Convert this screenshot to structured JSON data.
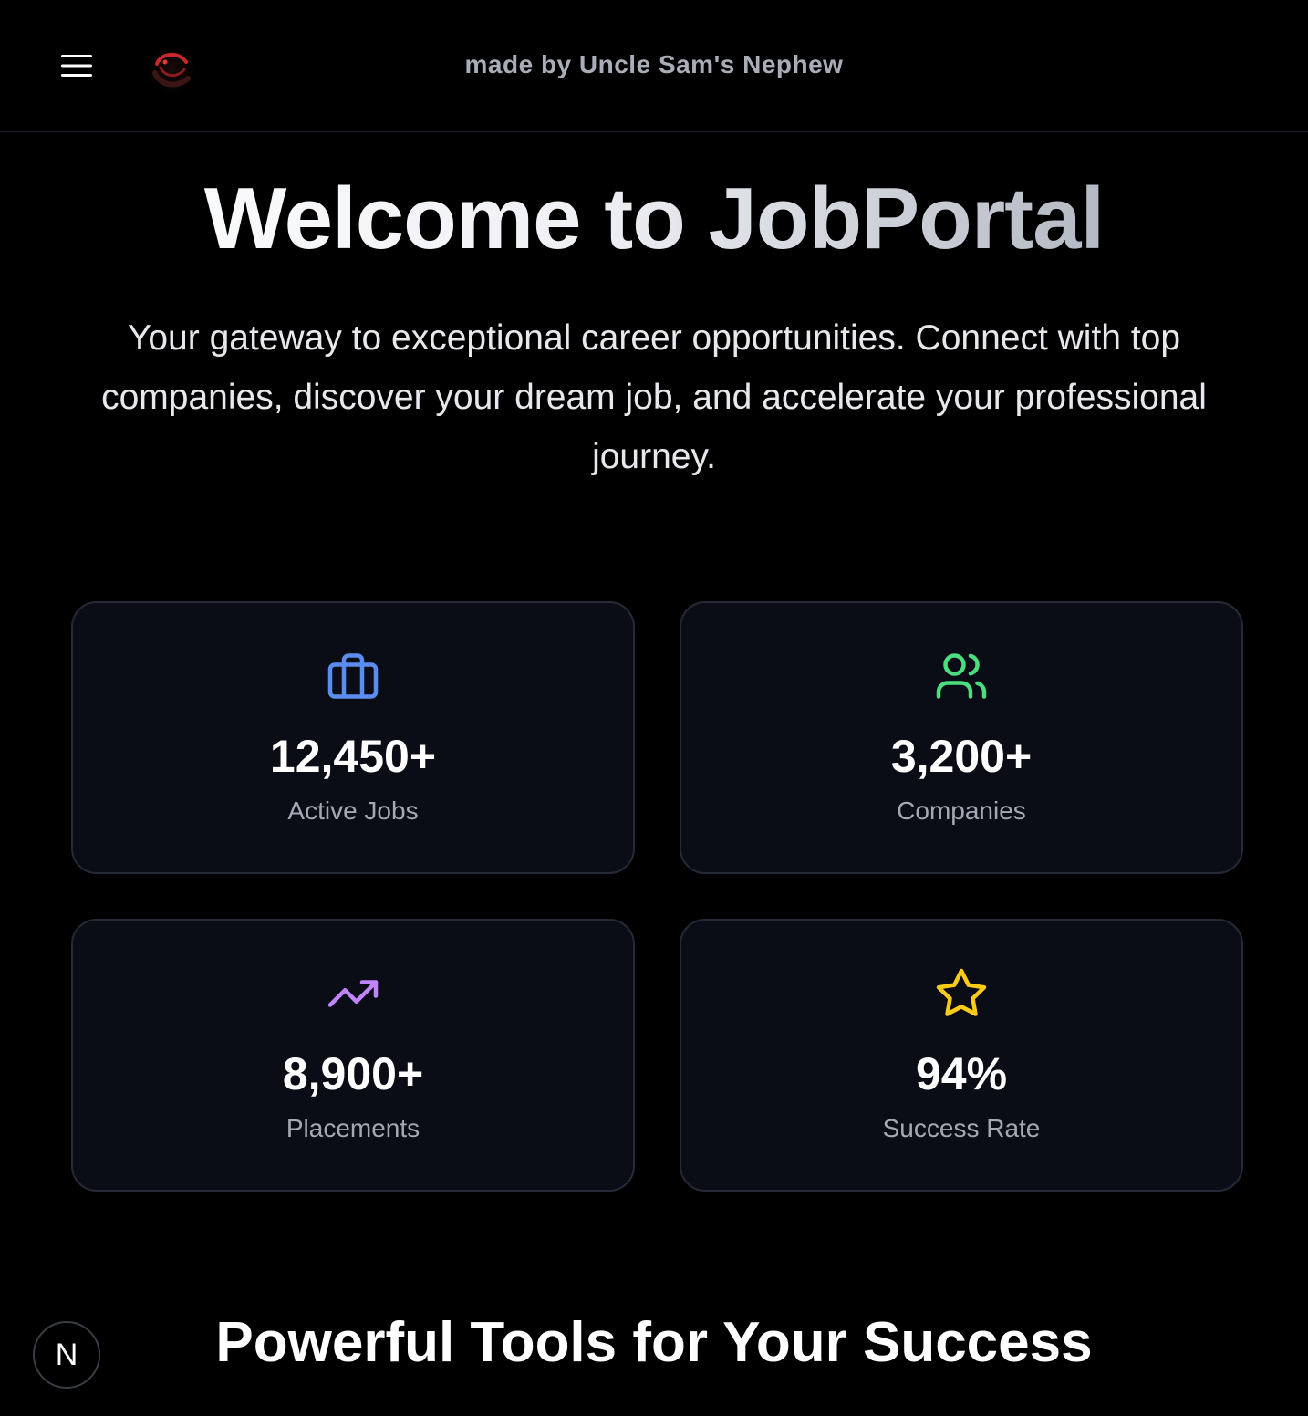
{
  "header": {
    "menu_icon": "hamburger-menu-icon",
    "logo_icon": "brand-logo",
    "credit": "made by Uncle Sam's Nephew"
  },
  "hero": {
    "title": "Welcome to JobPortal",
    "subtitle": "Your gateway to exceptional career opportunities. Connect with top companies, discover your dream job, and accelerate your professional journey."
  },
  "stats": [
    {
      "icon": "briefcase-icon",
      "color": "#5b8def",
      "value": "12,450+",
      "label": "Active Jobs"
    },
    {
      "icon": "users-icon",
      "color": "#4ade80",
      "value": "3,200+",
      "label": "Companies"
    },
    {
      "icon": "trending-up-icon",
      "color": "#c084fc",
      "value": "8,900+",
      "label": "Placements"
    },
    {
      "icon": "star-icon",
      "color": "#facc15",
      "value": "94%",
      "label": "Success Rate"
    }
  ],
  "features": {
    "title": "Powerful Tools for Your Success"
  },
  "dev_badge": {
    "letter": "N"
  },
  "colors": {
    "background": "#000000",
    "card_background": "#0b0d16",
    "card_border": "#262a36",
    "muted_text": "#a4a9b4"
  }
}
